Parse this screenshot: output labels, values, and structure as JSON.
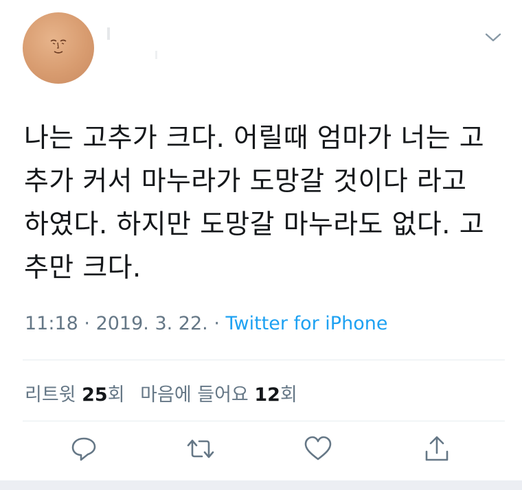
{
  "tweet": {
    "text_lines": [
      "나는 고추가 크다. 어릴때 엄마가 너는 고",
      "추가 커서 마누라가 도망갈 것이다 라고",
      "하였다. 하지만 도망갈 마누라도 없다. 고",
      "추만 크다."
    ],
    "time": "11:18",
    "date": "2019. 3. 22.",
    "source": "Twitter for iPhone",
    "retweets_label": "리트윗",
    "retweets_count": "25",
    "retweets_unit": "회",
    "likes_label": "마음에 들어요",
    "likes_count": "12",
    "likes_unit": "회"
  },
  "icons": {
    "more": "chevron-down-icon",
    "reply": "reply-icon",
    "retweet": "retweet-icon",
    "like": "heart-icon",
    "share": "share-icon"
  },
  "colors": {
    "text": "#14171a",
    "secondary": "#657786",
    "link": "#1da1f2",
    "divider": "#e6ecf0",
    "avatar": "#d89c70"
  }
}
